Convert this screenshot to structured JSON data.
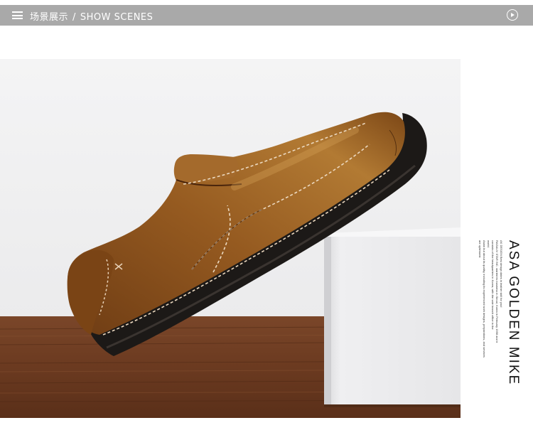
{
  "header": {
    "title_cn": "场景展示",
    "separator": "/",
    "title_en": "SHOW SCENES",
    "menu_icon": "menu-icon",
    "play_icon": "play-circle-icon"
  },
  "photo": {
    "subject": "brown-leather-loafer",
    "colors": {
      "leather": "#8a4f1a",
      "sole": "#1d1a18",
      "stitch": "#e8d2b8",
      "wood": "#6a3b22",
      "block": "#f0f0f2"
    }
  },
  "side_text": {
    "brand": "ASA GOLDEN MIKE",
    "fine_lines": [
      "AK DESIGN Best design dates in leather skill for you!",
      "RAGALIV STAR INC. started its business in Seoul, Korea in February 1998 and it",
      "consists of the headquarters in Korea, with the sale branch office in the",
      "world.",
      "Asian but about its quality, including its experienced work designs, preparations, and services",
      "are optimized."
    ]
  }
}
